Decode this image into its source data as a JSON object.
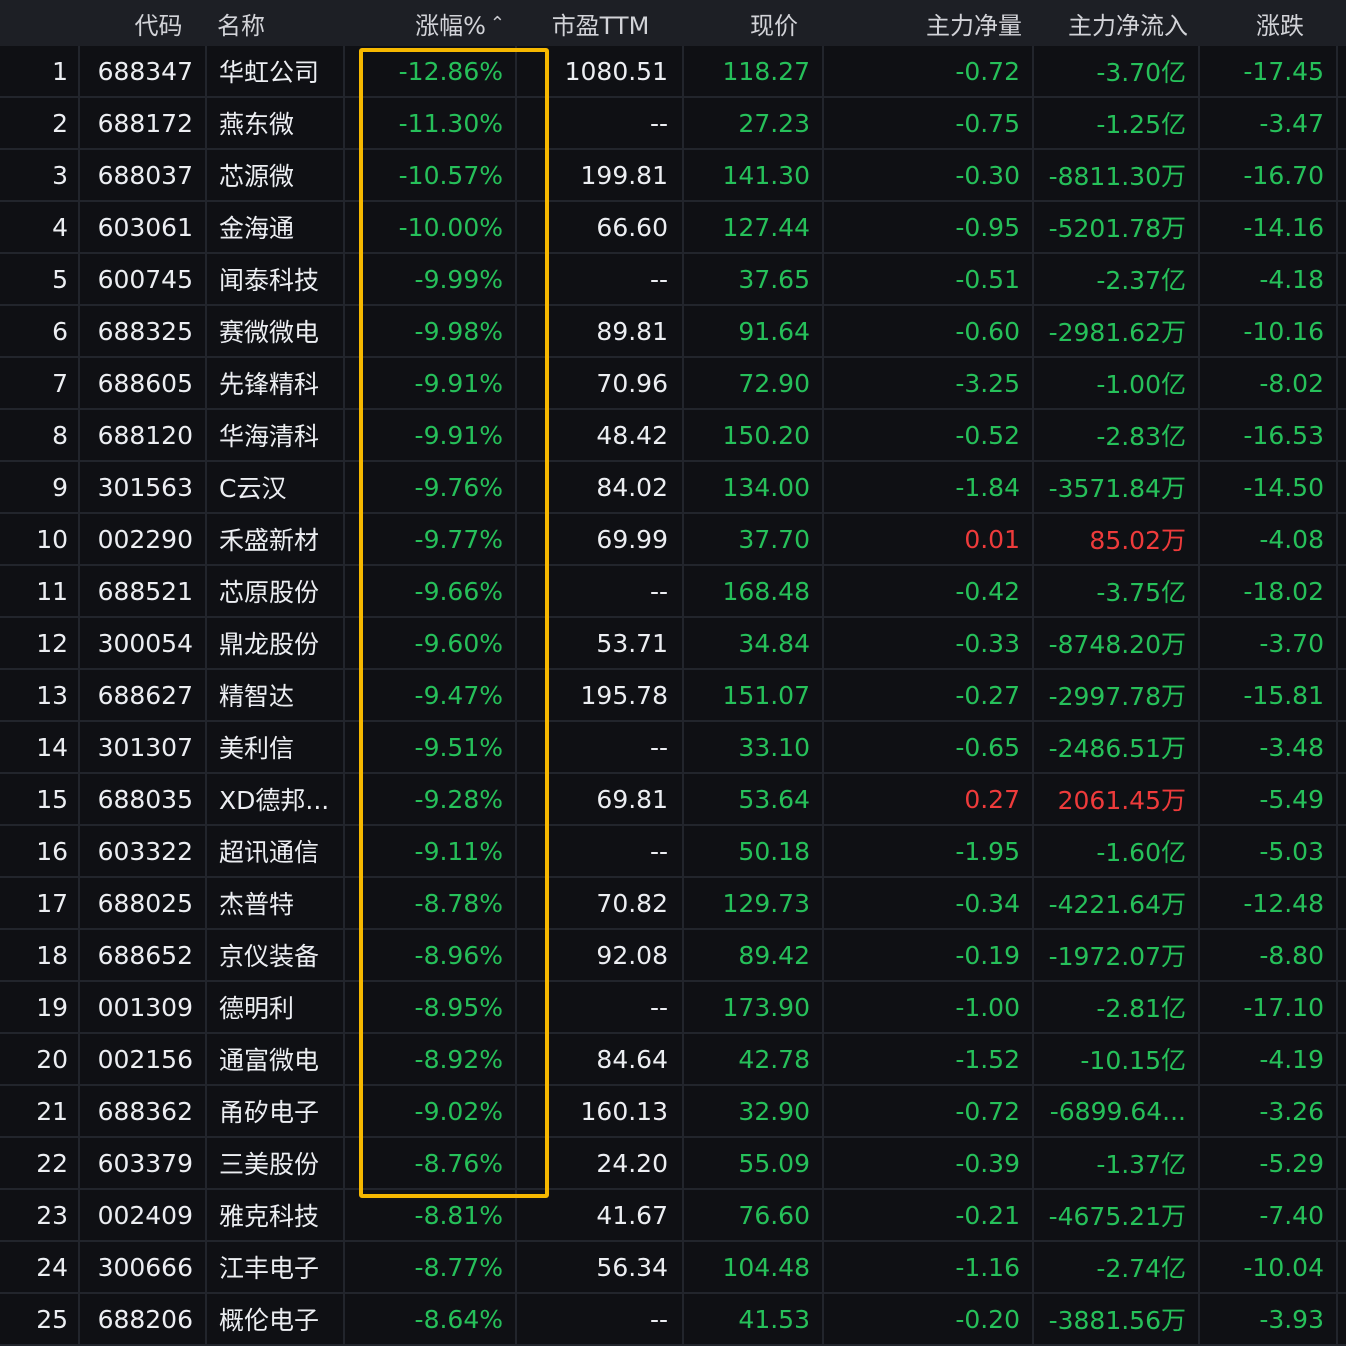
{
  "header": {
    "idx": "",
    "code": "代码",
    "name": "名称",
    "pct": "涨幅%",
    "sort_icon": "chevron-up-icon",
    "pe": "市盈TTM",
    "price": "现价",
    "net_volume": "主力净量",
    "net_inflow": "主力净流入",
    "change": "涨跌"
  },
  "colors": {
    "up": "#ee3b3b",
    "down": "#26c05a",
    "highlight": "#f6b800",
    "background": "#0f1014"
  },
  "rows": [
    {
      "idx": "1",
      "code": "688347",
      "name": "华虹公司",
      "pct": "-12.86%",
      "pe": "1080.51",
      "price": "118.27",
      "net_volume": "-0.72",
      "net_inflow": "-3.70亿",
      "change": "-17.45"
    },
    {
      "idx": "2",
      "code": "688172",
      "name": "燕东微",
      "pct": "-11.30%",
      "pe": "--",
      "price": "27.23",
      "net_volume": "-0.75",
      "net_inflow": "-1.25亿",
      "change": "-3.47"
    },
    {
      "idx": "3",
      "code": "688037",
      "name": "芯源微",
      "pct": "-10.57%",
      "pe": "199.81",
      "price": "141.30",
      "net_volume": "-0.30",
      "net_inflow": "-8811.30万",
      "change": "-16.70"
    },
    {
      "idx": "4",
      "code": "603061",
      "name": "金海通",
      "pct": "-10.00%",
      "pe": "66.60",
      "price": "127.44",
      "net_volume": "-0.95",
      "net_inflow": "-5201.78万",
      "change": "-14.16"
    },
    {
      "idx": "5",
      "code": "600745",
      "name": "闻泰科技",
      "pct": "-9.99%",
      "pe": "--",
      "price": "37.65",
      "net_volume": "-0.51",
      "net_inflow": "-2.37亿",
      "change": "-4.18"
    },
    {
      "idx": "6",
      "code": "688325",
      "name": "赛微微电",
      "pct": "-9.98%",
      "pe": "89.81",
      "price": "91.64",
      "net_volume": "-0.60",
      "net_inflow": "-2981.62万",
      "change": "-10.16"
    },
    {
      "idx": "7",
      "code": "688605",
      "name": "先锋精科",
      "pct": "-9.91%",
      "pe": "70.96",
      "price": "72.90",
      "net_volume": "-3.25",
      "net_inflow": "-1.00亿",
      "change": "-8.02"
    },
    {
      "idx": "8",
      "code": "688120",
      "name": "华海清科",
      "pct": "-9.91%",
      "pe": "48.42",
      "price": "150.20",
      "net_volume": "-0.52",
      "net_inflow": "-2.83亿",
      "change": "-16.53"
    },
    {
      "idx": "9",
      "code": "301563",
      "name": "C云汉",
      "pct": "-9.76%",
      "pe": "84.02",
      "price": "134.00",
      "net_volume": "-1.84",
      "net_inflow": "-3571.84万",
      "change": "-14.50"
    },
    {
      "idx": "10",
      "code": "002290",
      "name": "禾盛新材",
      "pct": "-9.77%",
      "pe": "69.99",
      "price": "37.70",
      "net_volume": "0.01",
      "net_inflow": "85.02万",
      "change": "-4.08",
      "flow_up": true
    },
    {
      "idx": "11",
      "code": "688521",
      "name": "芯原股份",
      "pct": "-9.66%",
      "pe": "--",
      "price": "168.48",
      "net_volume": "-0.42",
      "net_inflow": "-3.75亿",
      "change": "-18.02"
    },
    {
      "idx": "12",
      "code": "300054",
      "name": "鼎龙股份",
      "pct": "-9.60%",
      "pe": "53.71",
      "price": "34.84",
      "net_volume": "-0.33",
      "net_inflow": "-8748.20万",
      "change": "-3.70"
    },
    {
      "idx": "13",
      "code": "688627",
      "name": "精智达",
      "pct": "-9.47%",
      "pe": "195.78",
      "price": "151.07",
      "net_volume": "-0.27",
      "net_inflow": "-2997.78万",
      "change": "-15.81"
    },
    {
      "idx": "14",
      "code": "301307",
      "name": "美利信",
      "pct": "-9.51%",
      "pe": "--",
      "price": "33.10",
      "net_volume": "-0.65",
      "net_inflow": "-2486.51万",
      "change": "-3.48"
    },
    {
      "idx": "15",
      "code": "688035",
      "name": "XD德邦...",
      "pct": "-9.28%",
      "pe": "69.81",
      "price": "53.64",
      "net_volume": "0.27",
      "net_inflow": "2061.45万",
      "change": "-5.49",
      "flow_up": true
    },
    {
      "idx": "16",
      "code": "603322",
      "name": "超讯通信",
      "pct": "-9.11%",
      "pe": "--",
      "price": "50.18",
      "net_volume": "-1.95",
      "net_inflow": "-1.60亿",
      "change": "-5.03"
    },
    {
      "idx": "17",
      "code": "688025",
      "name": "杰普特",
      "pct": "-8.78%",
      "pe": "70.82",
      "price": "129.73",
      "net_volume": "-0.34",
      "net_inflow": "-4221.64万",
      "change": "-12.48"
    },
    {
      "idx": "18",
      "code": "688652",
      "name": "京仪装备",
      "pct": "-8.96%",
      "pe": "92.08",
      "price": "89.42",
      "net_volume": "-0.19",
      "net_inflow": "-1972.07万",
      "change": "-8.80"
    },
    {
      "idx": "19",
      "code": "001309",
      "name": "德明利",
      "pct": "-8.95%",
      "pe": "--",
      "price": "173.90",
      "net_volume": "-1.00",
      "net_inflow": "-2.81亿",
      "change": "-17.10"
    },
    {
      "idx": "20",
      "code": "002156",
      "name": "通富微电",
      "pct": "-8.92%",
      "pe": "84.64",
      "price": "42.78",
      "net_volume": "-1.52",
      "net_inflow": "-10.15亿",
      "change": "-4.19"
    },
    {
      "idx": "21",
      "code": "688362",
      "name": "甬矽电子",
      "pct": "-9.02%",
      "pe": "160.13",
      "price": "32.90",
      "net_volume": "-0.72",
      "net_inflow": "-6899.64...",
      "change": "-3.26"
    },
    {
      "idx": "22",
      "code": "603379",
      "name": "三美股份",
      "pct": "-8.76%",
      "pe": "24.20",
      "price": "55.09",
      "net_volume": "-0.39",
      "net_inflow": "-1.37亿",
      "change": "-5.29"
    },
    {
      "idx": "23",
      "code": "002409",
      "name": "雅克科技",
      "pct": "-8.81%",
      "pe": "41.67",
      "price": "76.60",
      "net_volume": "-0.21",
      "net_inflow": "-4675.21万",
      "change": "-7.40"
    },
    {
      "idx": "24",
      "code": "300666",
      "name": "江丰电子",
      "pct": "-8.77%",
      "pe": "56.34",
      "price": "104.48",
      "net_volume": "-1.16",
      "net_inflow": "-2.74亿",
      "change": "-10.04"
    },
    {
      "idx": "25",
      "code": "688206",
      "name": "概伦电子",
      "pct": "-8.64%",
      "pe": "--",
      "price": "41.53",
      "net_volume": "-0.20",
      "net_inflow": "-3881.56万",
      "change": "-3.93"
    }
  ]
}
